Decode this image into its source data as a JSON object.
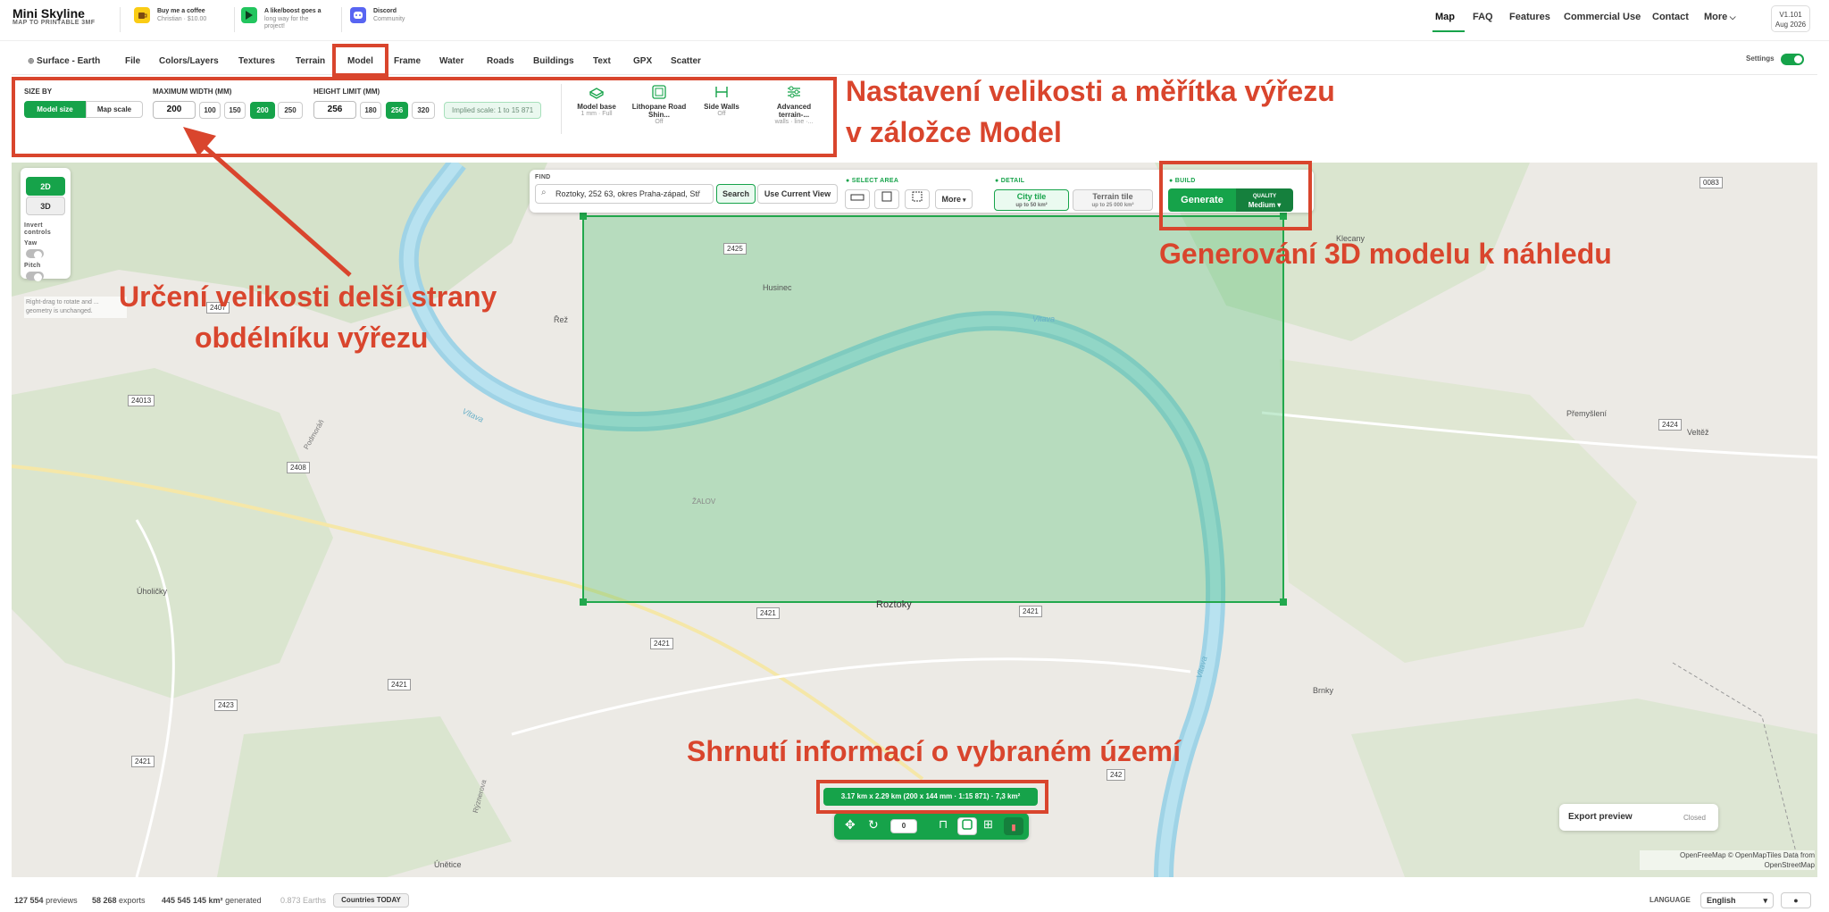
{
  "brand": {
    "title": "Mini Skyline",
    "subtitle": "MAP TO PRINTABLE 3MF"
  },
  "promos": [
    {
      "line1": "Buy me a coffee",
      "line2": "Christian · $10.00",
      "icon": "coffee-cup-icon",
      "color": "#facc15"
    },
    {
      "line1": "A like/boost goes a",
      "line2": "long way for the project!",
      "icon": "printables-icon",
      "color": "#22c55e"
    },
    {
      "line1": "Discord",
      "line2": "Community",
      "icon": "discord-icon",
      "color": "#5865f2"
    }
  ],
  "nav": [
    "Map",
    "FAQ",
    "Features",
    "Commercial Use",
    "Contact",
    "More"
  ],
  "version": {
    "number": "V1.101",
    "date": "Aug 2026"
  },
  "tabs": [
    "Surface - Earth",
    "File",
    "Colors/Layers",
    "Textures",
    "Terrain",
    "Model",
    "Frame",
    "Water",
    "Roads",
    "Buildings",
    "Text",
    "GPX",
    "Scatter"
  ],
  "active_tab": "Model",
  "settings_label": "Settings",
  "model_panel": {
    "size_by_label": "SIZE BY",
    "size_by_options": [
      "Model size",
      "Map scale"
    ],
    "size_by_selected": "Model size",
    "max_width_label": "MAXIMUM WIDTH (MM)",
    "max_width_value": "200",
    "max_width_presets": [
      "100",
      "150",
      "200",
      "250"
    ],
    "height_limit_label": "HEIGHT LIMIT (MM)",
    "height_limit_value": "256",
    "height_presets": [
      "180",
      "256",
      "320"
    ],
    "implied_scale": "Implied scale: 1 to 15 871",
    "tiles": [
      {
        "name": "Model base",
        "sub": "1 mm · Full",
        "icon": "model-base-icon"
      },
      {
        "name": "Lithopane Road Shin...",
        "sub": "Off",
        "icon": "lithophane-icon"
      },
      {
        "name": "Side Walls",
        "sub": "Off",
        "icon": "side-walls-icon"
      },
      {
        "name": "Advanced terrain-...",
        "sub": "walls · line ·...",
        "icon": "sliders-icon"
      }
    ]
  },
  "map_controls": {
    "mode_2d": "2D",
    "mode_3d": "3D",
    "invert_label": "Invert controls",
    "yaw_label": "Yaw",
    "pitch_label": "Pitch",
    "hint": "Right-drag to rotate and ... geometry is unchanged."
  },
  "find": {
    "label": "FIND",
    "value": "Roztoky, 252 63, okres Praha-západ, Stř",
    "search_button": "Search",
    "current_view_button": "Use Current View"
  },
  "select_area": {
    "label": "SELECT AREA",
    "more": "More"
  },
  "detail": {
    "label": "DETAIL",
    "city_tile": "City tile",
    "city_sub": "up to 50 km²",
    "terrain_tile": "Terrain tile",
    "terrain_sub": "up to 25 000 km²"
  },
  "build": {
    "label": "BUILD",
    "generate": "Generate",
    "quality_label": "QUALITY",
    "quality_value": "Medium"
  },
  "selection_summary": "3.17 km x 2.29 km (200 x 144 mm · 1:15 871) · 7,3 km²",
  "rotation_value": "0",
  "map_labels": {
    "places": [
      "Husinec",
      "Řež",
      "Klecany",
      "Přemyšlení",
      "Veltěž",
      "Úholičky",
      "Roztoky",
      "Brnky",
      "Únětice",
      "ŽALOV"
    ],
    "rivers": [
      "Vltava",
      "Vltava",
      "Vltava"
    ],
    "streets": [
      "Podmoráň",
      "Rýznerova"
    ],
    "roads": [
      "0083",
      "2425",
      "2407",
      "24013",
      "2408",
      "2421",
      "2421",
      "2421",
      "2421",
      "2423",
      "2421",
      "2424",
      "242"
    ]
  },
  "export_preview": {
    "title": "Export preview",
    "status": "Closed"
  },
  "attribution": "OpenFreeMap © OpenMapTiles Data from OpenStreetMap",
  "annotations": {
    "model_tab": "Nastavení velikosti a měřítka výřezu",
    "model_tab_2": "v záložce Model",
    "width": "Určení velikosti delší strany",
    "width_2": "obdélníku výřezu",
    "generate": "Generování 3D modelu k náhledu",
    "summary": "Shrnutí informací o vybraném území"
  },
  "footer": {
    "previews_value": "127 554",
    "previews_label": "previews",
    "exports_value": "58 268",
    "exports_label": "exports",
    "area_value": "445 545 145 km²",
    "area_label": "generated",
    "earths": "0.873 Earths",
    "countries_button": "Countries TODAY",
    "language_label": "LANGUAGE",
    "language_value": "English"
  },
  "colors": {
    "accent": "#16a34a",
    "annotation": "#d9452d"
  }
}
